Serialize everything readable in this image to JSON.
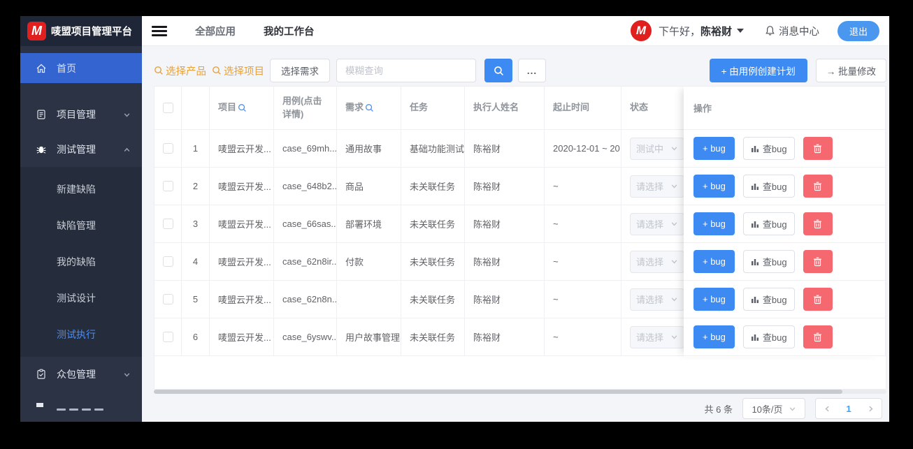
{
  "colors": {
    "accent": "#3d8af2",
    "danger": "#f6686f",
    "link_orange": "#e6a23c",
    "sidebar_active_bg": "#3464d0",
    "logo_red": "#e01f1f"
  },
  "app": {
    "title": "唛盟项目管理平台",
    "logo_letter": "M"
  },
  "topnav": {
    "menu": [
      {
        "label": "全部应用"
      },
      {
        "label": "我的工作台"
      }
    ],
    "greeting": "下午好，",
    "username": "陈裕财",
    "message_center": "消息中心",
    "logout_label": "退出",
    "avatar_letter": "M"
  },
  "sidebar": {
    "home": "首页",
    "project_mgmt": "项目管理",
    "test_mgmt": "测试管理",
    "crowd_mgmt": "众包管理",
    "submenu": [
      {
        "label": "新建缺陷"
      },
      {
        "label": "缺陷管理"
      },
      {
        "label": "我的缺陷"
      },
      {
        "label": "测试设计"
      },
      {
        "label": "测试执行"
      }
    ],
    "active_item": "测试执行"
  },
  "toolbar": {
    "select_product": "选择产品",
    "select_project": "选择项目",
    "select_requirement": "选择需求",
    "search_placeholder": "模糊查询",
    "more_label": "...",
    "create_plan": "+ 由用例创建计划",
    "batch_edit": "→ 批量修改"
  },
  "table": {
    "headers": {
      "project": "项目",
      "usecase": "用例(点击详情)",
      "requirement": "需求",
      "task": "任务",
      "executor": "执行人姓名",
      "date_range": "起止时间",
      "status": "状态",
      "actions": "操作"
    },
    "op_labels": {
      "add_bug": "+ bug",
      "view_bug": "查bug"
    },
    "rows": [
      {
        "index": "1",
        "project": "唛盟云开发...",
        "usecase": "case_69mh...",
        "requirement": "通用故事",
        "task": "基础功能测试",
        "executor": "陈裕财",
        "date_range": "2020-12-01 ~ 20",
        "status": "测试中"
      },
      {
        "index": "2",
        "project": "唛盟云开发...",
        "usecase": "case_648b2...",
        "requirement": "商品",
        "task": "未关联任务",
        "executor": "陈裕财",
        "date_range": "~",
        "status": "请选择"
      },
      {
        "index": "3",
        "project": "唛盟云开发...",
        "usecase": "case_66sas...",
        "requirement": "部署环境",
        "task": "未关联任务",
        "executor": "陈裕财",
        "date_range": "~",
        "status": "请选择"
      },
      {
        "index": "4",
        "project": "唛盟云开发...",
        "usecase": "case_62n8ir...",
        "requirement": "付款",
        "task": "未关联任务",
        "executor": "陈裕财",
        "date_range": "~",
        "status": "请选择"
      },
      {
        "index": "5",
        "project": "唛盟云开发...",
        "usecase": "case_62n8n...",
        "requirement": "",
        "task": "未关联任务",
        "executor": "陈裕财",
        "date_range": "~",
        "status": "请选择"
      },
      {
        "index": "6",
        "project": "唛盟云开发...",
        "usecase": "case_6yswv...",
        "requirement": "用户故事管理",
        "task": "未关联任务",
        "executor": "陈裕财",
        "date_range": "~",
        "status": "请选择"
      }
    ]
  },
  "pagination": {
    "total": "共 6 条",
    "page_size": "10条/页",
    "current_page": "1"
  }
}
